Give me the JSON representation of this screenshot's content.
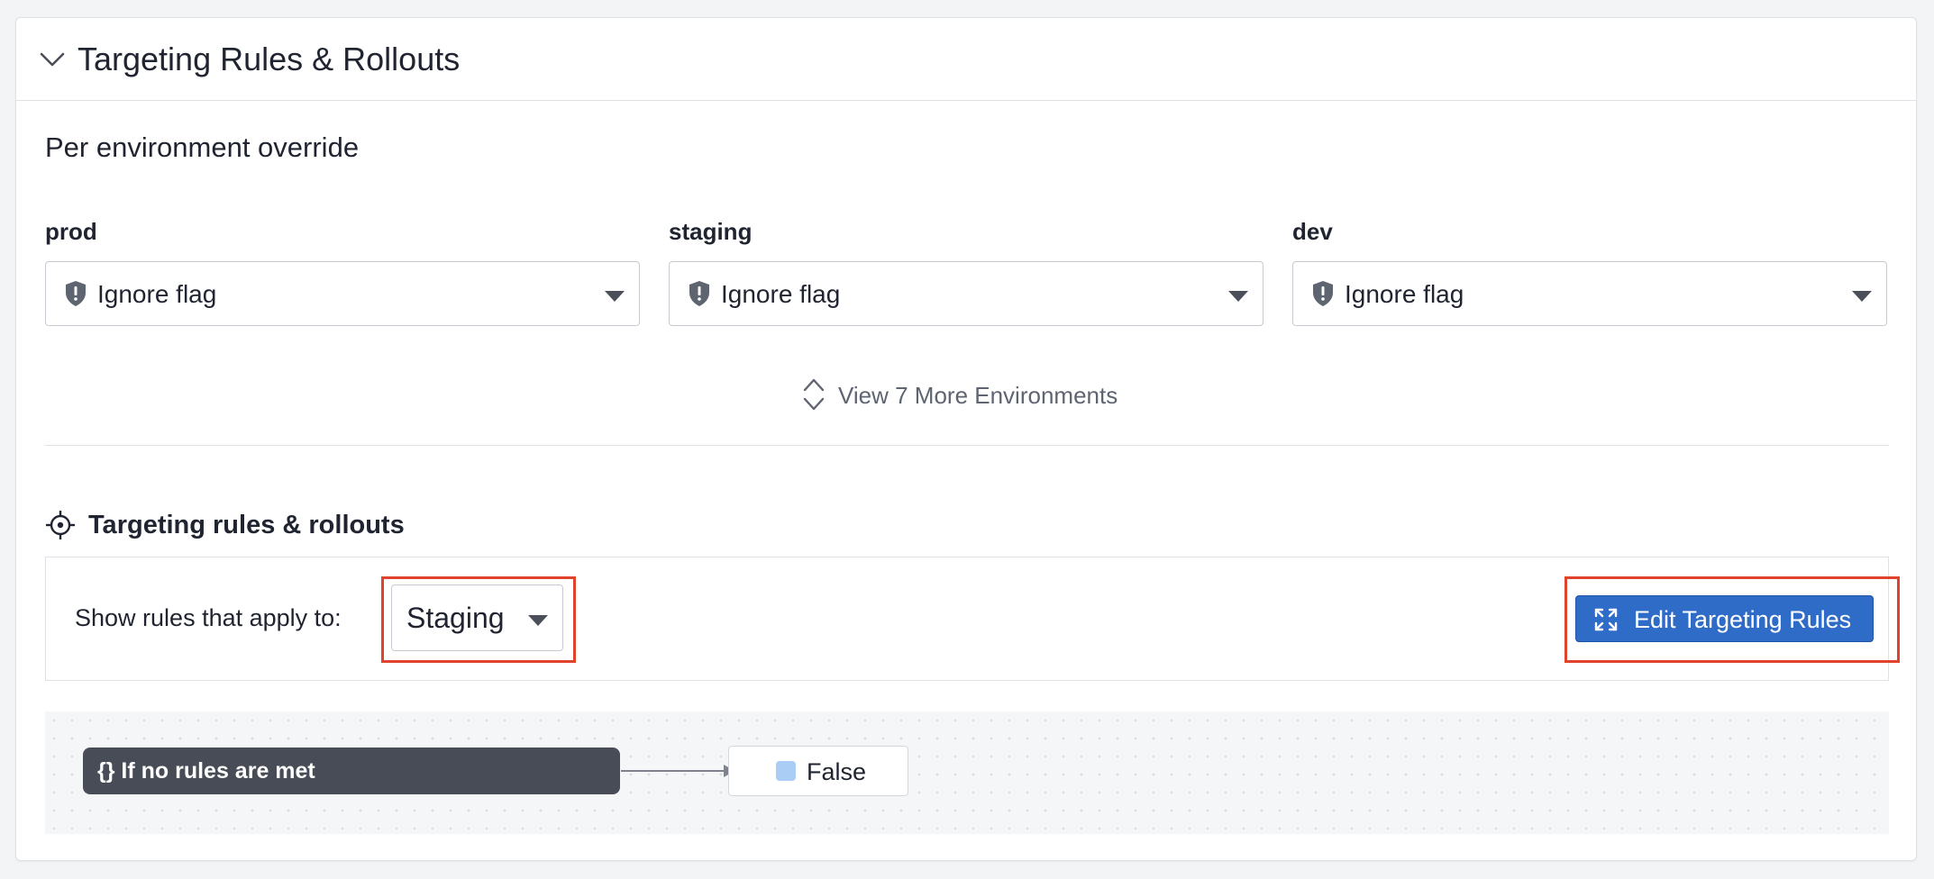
{
  "header": {
    "title": "Targeting Rules & Rollouts",
    "collapse_icon": "chevron-down-icon"
  },
  "override": {
    "section_title": "Per environment override",
    "environments": [
      {
        "name": "prod",
        "value": "Ignore flag",
        "icon": "shield-alert-icon"
      },
      {
        "name": "staging",
        "value": "Ignore flag",
        "icon": "shield-alert-icon"
      },
      {
        "name": "dev",
        "value": "Ignore flag",
        "icon": "shield-alert-icon"
      }
    ],
    "view_more_label": "View 7 More Environments",
    "view_more_icon": "expand-vertical-icon"
  },
  "targeting": {
    "title": "Targeting rules & rollouts",
    "icon": "target-icon",
    "filter_label": "Show rules that apply to:",
    "selected_environment": "Staging",
    "edit_button_label": "Edit Targeting Rules",
    "edit_button_icon": "expand-icon"
  },
  "flow": {
    "rule_label": "{} If no rules are met",
    "result_label": "False",
    "result_swatch_color": "#a9cdf5"
  },
  "colors": {
    "primary": "#2e6cc8",
    "highlight": "#e0432c",
    "node_dark": "#474c57"
  }
}
